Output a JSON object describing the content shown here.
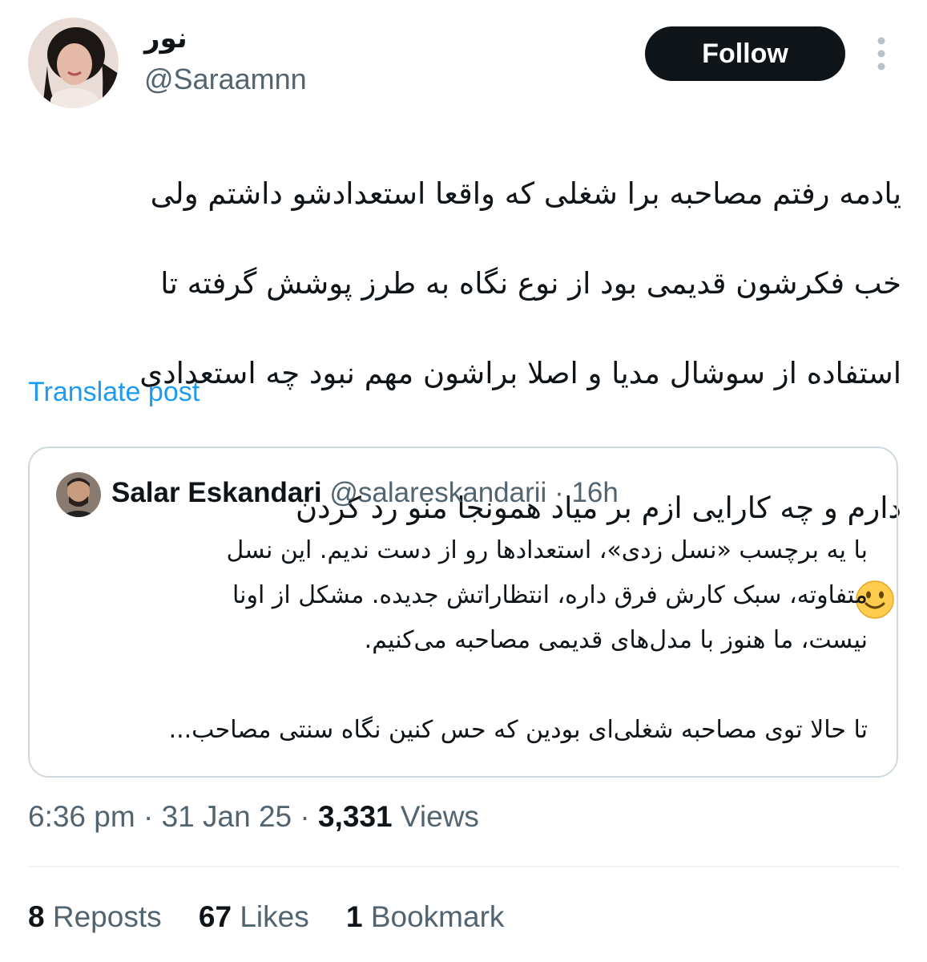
{
  "author": {
    "display_name": "نور",
    "handle": "@Saraamnn",
    "avatar_icon": "profile-photo"
  },
  "follow_button": {
    "label": "Follow"
  },
  "more_icon": "more-vertical-icon",
  "post": {
    "lines": [
      "یادمه رفتم مصاحبه برا شغلی که واقعا استعدادشو داشتم ولی",
      "خب فکرشون قدیمی بود از نوع نگاه به طرز پوشش  گرفته تا",
      "استفاده از  سوشال مدیا و اصلا براشون مهم نبود چه استعدادی",
      "دارم و چه کارایی ازم بر میاد همونجا منو رد کردن"
    ],
    "emoji": "🙂"
  },
  "translate_label": "Translate post",
  "quote": {
    "name": "Salar Eskandari",
    "handle": "@salareskandarii",
    "separator": "·",
    "time": "16h",
    "lines": [
      "با یه برچسب «نسل زدی»، استعدادها رو از دست ندیم. این نسل",
      "متفاوته، سبک کارش فرق داره، انتظاراتش جدیده. مشکل از اونا",
      "نیست، ما هنوز با مدل‌های قدیمی مصاحبه می‌کنیم."
    ],
    "last_line": "تا حالا توی مصاحبه شغلی‌ای بودین که حس کنین نگاه سنتی مصاحب..."
  },
  "meta": {
    "time": "6:36 pm",
    "date": "31 Jan 25",
    "views_count": "3,331",
    "views_label": "Views",
    "sep": "·"
  },
  "stats": {
    "reposts_count": "8",
    "reposts_label": "Reposts",
    "likes_count": "67",
    "likes_label": "Likes",
    "bookmarks_count": "1",
    "bookmarks_label": "Bookmark"
  },
  "colors": {
    "text": "#0f1419",
    "secondary": "#536471",
    "link": "#1d9bf0",
    "border": "#cfd9de",
    "button_bg": "#0f1419"
  }
}
